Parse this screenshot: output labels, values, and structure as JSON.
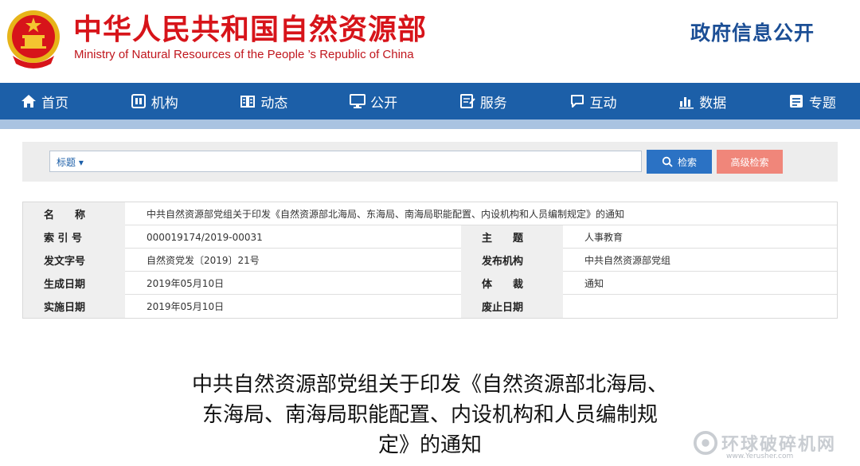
{
  "header": {
    "title_cn": "中华人民共和国自然资源部",
    "title_en": "Ministry of Natural Resources of the People ’s Republic of China",
    "gov_info_open": "政府信息公开"
  },
  "nav": {
    "items": [
      {
        "label": "首页",
        "icon": "home-icon"
      },
      {
        "label": "机构",
        "icon": "organization-icon"
      },
      {
        "label": "动态",
        "icon": "news-icon"
      },
      {
        "label": "公开",
        "icon": "monitor-icon"
      },
      {
        "label": "服务",
        "icon": "service-icon"
      },
      {
        "label": "互动",
        "icon": "chat-icon"
      },
      {
        "label": "数据",
        "icon": "bar-chart-icon"
      },
      {
        "label": "专题",
        "icon": "topic-icon"
      }
    ]
  },
  "search": {
    "field_select": "标题 ▾",
    "input_value": "",
    "search_label": "检索",
    "advanced_label": "高级检索"
  },
  "info": {
    "name_label": "名　　称",
    "name_value": "中共自然资源部党组关于印发《自然资源部北海局、东海局、南海局职能配置、内设机构和人员编制规定》的通知",
    "index_label": "索 引 号",
    "index_value": "000019174/2019-00031",
    "topic_label": "主　　题",
    "topic_value": "人事教育",
    "doc_no_label": "发文字号",
    "doc_no_value": "自然资党发〔2019〕21号",
    "issuer_label": "发布机构",
    "issuer_value": "中共自然资源部党组",
    "created_label": "生成日期",
    "created_value": "2019年05月10日",
    "genre_label": "体　　裁",
    "genre_value": "通知",
    "effective_label": "实施日期",
    "effective_value": "2019年05月10日",
    "abolish_label": "废止日期",
    "abolish_value": ""
  },
  "doc": {
    "title_line1": "中共自然资源部党组关于印发《自然资源部北海局、",
    "title_line2": "东海局、南海局职能配置、内设机构和人员编制规",
    "title_line3": "定》的通知"
  },
  "watermark": {
    "text": "环球破碎机网",
    "url": "www.Yerusher.com"
  },
  "colors": {
    "brand_red": "#d7141a",
    "nav_blue": "#1c5fa8",
    "search_blue": "#2b72c4",
    "advanced_red": "#f0867a"
  }
}
